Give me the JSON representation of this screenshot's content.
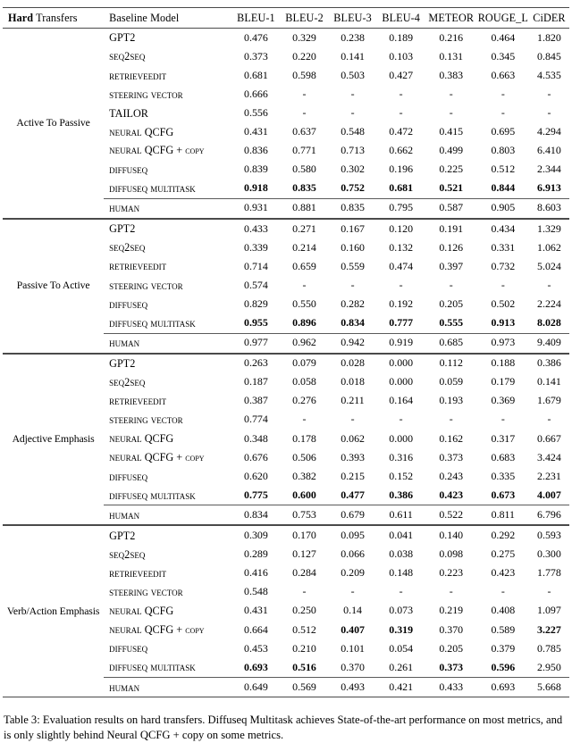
{
  "table": {
    "header": {
      "group_bold": "Hard",
      "group_rest": " Transfers",
      "model": "Baseline Model",
      "metrics": [
        "BLEU-1",
        "BLEU-2",
        "BLEU-3",
        "BLEU-4",
        "METEOR",
        "ROUGE_L",
        "CiDER"
      ]
    },
    "sections": [
      {
        "group": "Active To Passive",
        "rows": [
          {
            "model": "GPT2",
            "style": "plain",
            "values": [
              "0.476",
              "0.329",
              "0.238",
              "0.189",
              "0.216",
              "0.464",
              "1.820"
            ],
            "bold": [
              false,
              false,
              false,
              false,
              false,
              false,
              false
            ]
          },
          {
            "model": "Seq2seq",
            "style": "sc",
            "values": [
              "0.373",
              "0.220",
              "0.141",
              "0.103",
              "0.131",
              "0.345",
              "0.845"
            ],
            "bold": [
              false,
              false,
              false,
              false,
              false,
              false,
              false
            ]
          },
          {
            "model": "RetrieveEdit",
            "style": "sc",
            "values": [
              "0.681",
              "0.598",
              "0.503",
              "0.427",
              "0.383",
              "0.663",
              "4.535"
            ],
            "bold": [
              false,
              false,
              false,
              false,
              false,
              false,
              false
            ]
          },
          {
            "model": "Steering Vector",
            "style": "sc",
            "values": [
              "0.666",
              "-",
              "-",
              "-",
              "-",
              "-",
              "-"
            ],
            "bold": [
              false,
              false,
              false,
              false,
              false,
              false,
              false
            ]
          },
          {
            "model": "TAILOR",
            "style": "plain",
            "values": [
              "0.556",
              "-",
              "-",
              "-",
              "-",
              "-",
              "-"
            ],
            "bold": [
              false,
              false,
              false,
              false,
              false,
              false,
              false
            ]
          },
          {
            "model": "Neural QCFG",
            "style": "sc-qcfg",
            "values": [
              "0.431",
              "0.637",
              "0.548",
              "0.472",
              "0.415",
              "0.695",
              "4.294"
            ],
            "bold": [
              false,
              false,
              false,
              false,
              false,
              false,
              false
            ]
          },
          {
            "model": "Neural QCFG + copy",
            "style": "sc-qcfg-copy",
            "values": [
              "0.836",
              "0.771",
              "0.713",
              "0.662",
              "0.499",
              "0.803",
              "6.410"
            ],
            "bold": [
              false,
              false,
              false,
              false,
              false,
              false,
              false
            ]
          },
          {
            "model": "DiffuSeq",
            "style": "sc",
            "values": [
              "0.839",
              "0.580",
              "0.302",
              "0.196",
              "0.225",
              "0.512",
              "2.344"
            ],
            "bold": [
              false,
              false,
              false,
              false,
              false,
              false,
              false
            ]
          },
          {
            "model": "DiffuSeq MultiTask",
            "style": "sc",
            "values": [
              "0.918",
              "0.835",
              "0.752",
              "0.681",
              "0.521",
              "0.844",
              "6.913"
            ],
            "bold": [
              true,
              true,
              true,
              true,
              true,
              true,
              true
            ]
          }
        ],
        "human": {
          "model": "Human",
          "style": "sc",
          "values": [
            "0.931",
            "0.881",
            "0.835",
            "0.795",
            "0.587",
            "0.905",
            "8.603"
          ],
          "bold": [
            false,
            false,
            false,
            false,
            false,
            false,
            false
          ]
        }
      },
      {
        "group": "Passive To Active",
        "rows": [
          {
            "model": "GPT2",
            "style": "plain",
            "values": [
              "0.433",
              "0.271",
              "0.167",
              "0.120",
              "0.191",
              "0.434",
              "1.329"
            ],
            "bold": [
              false,
              false,
              false,
              false,
              false,
              false,
              false
            ]
          },
          {
            "model": "Seq2seq",
            "style": "sc",
            "values": [
              "0.339",
              "0.214",
              "0.160",
              "0.132",
              "0.126",
              "0.331",
              "1.062"
            ],
            "bold": [
              false,
              false,
              false,
              false,
              false,
              false,
              false
            ]
          },
          {
            "model": "RetrieveEdit",
            "style": "sc",
            "values": [
              "0.714",
              "0.659",
              "0.559",
              "0.474",
              "0.397",
              "0.732",
              "5.024"
            ],
            "bold": [
              false,
              false,
              false,
              false,
              false,
              false,
              false
            ]
          },
          {
            "model": "Steering Vector",
            "style": "sc",
            "values": [
              "0.574",
              "-",
              "-",
              "-",
              "-",
              "-",
              "-"
            ],
            "bold": [
              false,
              false,
              false,
              false,
              false,
              false,
              false
            ]
          },
          {
            "model": "DiffuSeq",
            "style": "sc",
            "values": [
              "0.829",
              "0.550",
              "0.282",
              "0.192",
              "0.205",
              "0.502",
              "2.224"
            ],
            "bold": [
              false,
              false,
              false,
              false,
              false,
              false,
              false
            ]
          },
          {
            "model": "DiffuSeq MultiTask",
            "style": "sc",
            "values": [
              "0.955",
              "0.896",
              "0.834",
              "0.777",
              "0.555",
              "0.913",
              "8.028"
            ],
            "bold": [
              true,
              true,
              true,
              true,
              true,
              true,
              true
            ]
          }
        ],
        "human": {
          "model": "Human",
          "style": "sc",
          "values": [
            "0.977",
            "0.962",
            "0.942",
            "0.919",
            "0.685",
            "0.973",
            "9.409"
          ],
          "bold": [
            false,
            false,
            false,
            false,
            false,
            false,
            false
          ]
        }
      },
      {
        "group": "Adjective Emphasis",
        "rows": [
          {
            "model": "GPT2",
            "style": "plain",
            "values": [
              "0.263",
              "0.079",
              "0.028",
              "0.000",
              "0.112",
              "0.188",
              "0.386"
            ],
            "bold": [
              false,
              false,
              false,
              false,
              false,
              false,
              false
            ]
          },
          {
            "model": "Seq2seq",
            "style": "sc",
            "values": [
              "0.187",
              "0.058",
              "0.018",
              "0.000",
              "0.059",
              "0.179",
              "0.141"
            ],
            "bold": [
              false,
              false,
              false,
              false,
              false,
              false,
              false
            ]
          },
          {
            "model": "RetrieveEdit",
            "style": "sc",
            "values": [
              "0.387",
              "0.276",
              "0.211",
              "0.164",
              "0.193",
              "0.369",
              "1.679"
            ],
            "bold": [
              false,
              false,
              false,
              false,
              false,
              false,
              false
            ]
          },
          {
            "model": "Steering Vector",
            "style": "sc",
            "values": [
              "0.774",
              "-",
              "-",
              "-",
              "-",
              "-",
              "-"
            ],
            "bold": [
              false,
              false,
              false,
              false,
              false,
              false,
              false
            ]
          },
          {
            "model": "Neural QCFG",
            "style": "sc-qcfg",
            "values": [
              "0.348",
              "0.178",
              "0.062",
              "0.000",
              "0.162",
              "0.317",
              "0.667"
            ],
            "bold": [
              false,
              false,
              false,
              false,
              false,
              false,
              false
            ]
          },
          {
            "model": "Neural QCFG + copy",
            "style": "sc-qcfg-copy",
            "values": [
              "0.676",
              "0.506",
              "0.393",
              "0.316",
              "0.373",
              "0.683",
              "3.424"
            ],
            "bold": [
              false,
              false,
              false,
              false,
              false,
              false,
              false
            ]
          },
          {
            "model": "DiffuSeq",
            "style": "sc",
            "values": [
              "0.620",
              "0.382",
              "0.215",
              "0.152",
              "0.243",
              "0.335",
              "2.231"
            ],
            "bold": [
              false,
              false,
              false,
              false,
              false,
              false,
              false
            ]
          },
          {
            "model": "DiffuSeq MultiTask",
            "style": "sc",
            "values": [
              "0.775",
              "0.600",
              "0.477",
              "0.386",
              "0.423",
              "0.673",
              "4.007"
            ],
            "bold": [
              true,
              true,
              true,
              true,
              true,
              true,
              true
            ]
          }
        ],
        "human": {
          "model": "Human",
          "style": "sc",
          "values": [
            "0.834",
            "0.753",
            "0.679",
            "0.611",
            "0.522",
            "0.811",
            "6.796"
          ],
          "bold": [
            false,
            false,
            false,
            false,
            false,
            false,
            false
          ]
        }
      },
      {
        "group": "Verb/Action Emphasis",
        "rows": [
          {
            "model": "GPT2",
            "style": "plain",
            "values": [
              "0.309",
              "0.170",
              "0.095",
              "0.041",
              "0.140",
              "0.292",
              "0.593"
            ],
            "bold": [
              false,
              false,
              false,
              false,
              false,
              false,
              false
            ]
          },
          {
            "model": "Seq2seq",
            "style": "sc",
            "values": [
              "0.289",
              "0.127",
              "0.066",
              "0.038",
              "0.098",
              "0.275",
              "0.300"
            ],
            "bold": [
              false,
              false,
              false,
              false,
              false,
              false,
              false
            ]
          },
          {
            "model": "RetrieveEdit",
            "style": "sc",
            "values": [
              "0.416",
              "0.284",
              "0.209",
              "0.148",
              "0.223",
              "0.423",
              "1.778"
            ],
            "bold": [
              false,
              false,
              false,
              false,
              false,
              false,
              false
            ]
          },
          {
            "model": "Steering Vector",
            "style": "sc",
            "values": [
              "0.548",
              "-",
              "-",
              "-",
              "-",
              "-",
              "-"
            ],
            "bold": [
              false,
              false,
              false,
              false,
              false,
              false,
              false
            ]
          },
          {
            "model": "Neural QCFG",
            "style": "sc-qcfg",
            "values": [
              "0.431",
              "0.250",
              "0.14",
              "0.073",
              "0.219",
              "0.408",
              "1.097"
            ],
            "bold": [
              false,
              false,
              false,
              false,
              false,
              false,
              false
            ]
          },
          {
            "model": "Neural QCFG + copy",
            "style": "sc-qcfg-copy",
            "values": [
              "0.664",
              "0.512",
              "0.407",
              "0.319",
              "0.370",
              "0.589",
              "3.227"
            ],
            "bold": [
              false,
              false,
              true,
              true,
              false,
              false,
              true
            ]
          },
          {
            "model": "DiffuSeq",
            "style": "sc",
            "values": [
              "0.453",
              "0.210",
              "0.101",
              "0.054",
              "0.205",
              "0.379",
              "0.785"
            ],
            "bold": [
              false,
              false,
              false,
              false,
              false,
              false,
              false
            ]
          },
          {
            "model": "DiffuSeq MultiTask",
            "style": "sc",
            "values": [
              "0.693",
              "0.516",
              "0.370",
              "0.261",
              "0.373",
              "0.596",
              "2.950"
            ],
            "bold": [
              true,
              true,
              false,
              false,
              true,
              true,
              false
            ]
          }
        ],
        "human": {
          "model": "Human",
          "style": "sc",
          "values": [
            "0.649",
            "0.569",
            "0.493",
            "0.421",
            "0.433",
            "0.693",
            "5.668"
          ],
          "bold": [
            false,
            false,
            false,
            false,
            false,
            false,
            false
          ]
        }
      }
    ]
  },
  "caption": {
    "text": "Table 3: Evaluation results on hard transfers. Diffuseq Multitask achieves State-of-the-art performance on most metrics, and is only slightly behind Neural QCFG + copy on some metrics."
  }
}
